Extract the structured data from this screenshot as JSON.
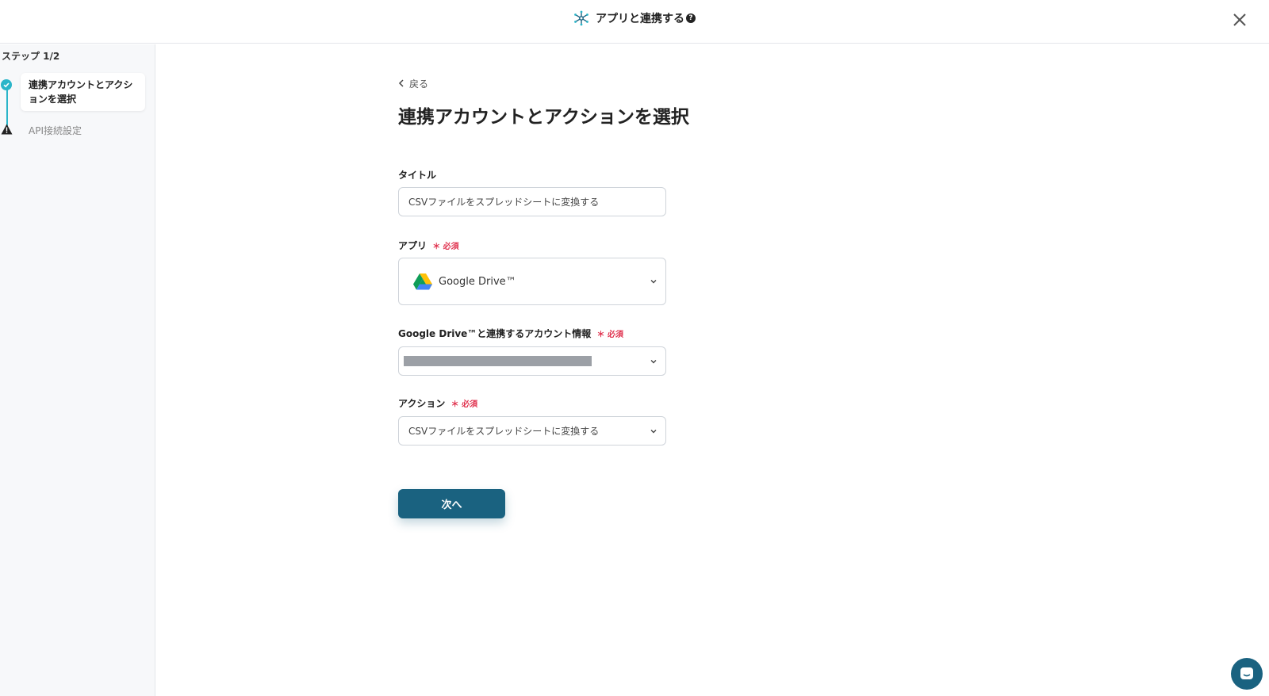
{
  "header": {
    "title": "アプリと連携する",
    "help_glyph": "?",
    "close_label": "×"
  },
  "sidebar": {
    "step_count": "ステップ 1/2",
    "steps": [
      {
        "label": "連携アカウントとアクションを選択",
        "status": "done"
      },
      {
        "label": "API接続設定",
        "status": "warning"
      }
    ]
  },
  "main": {
    "back_label": "戻る",
    "page_title": "連携アカウントとアクションを選択",
    "fields": {
      "title": {
        "label": "タイトル",
        "value": "CSVファイルをスプレッドシートに変換する"
      },
      "app": {
        "label": "アプリ",
        "required": "＊ 必須",
        "value": "Google Drive™"
      },
      "account": {
        "label": "Google Drive™と連携するアカウント情報",
        "required": "＊ 必須"
      },
      "action": {
        "label": "アクション",
        "required": "＊ 必須",
        "value": "CSVファイルをスプレッドシートに変換する"
      }
    },
    "next_label": "次へ"
  },
  "colors": {
    "accent": "#1a6280",
    "step_active": "#2bb5c9",
    "required": "#e0334f"
  }
}
